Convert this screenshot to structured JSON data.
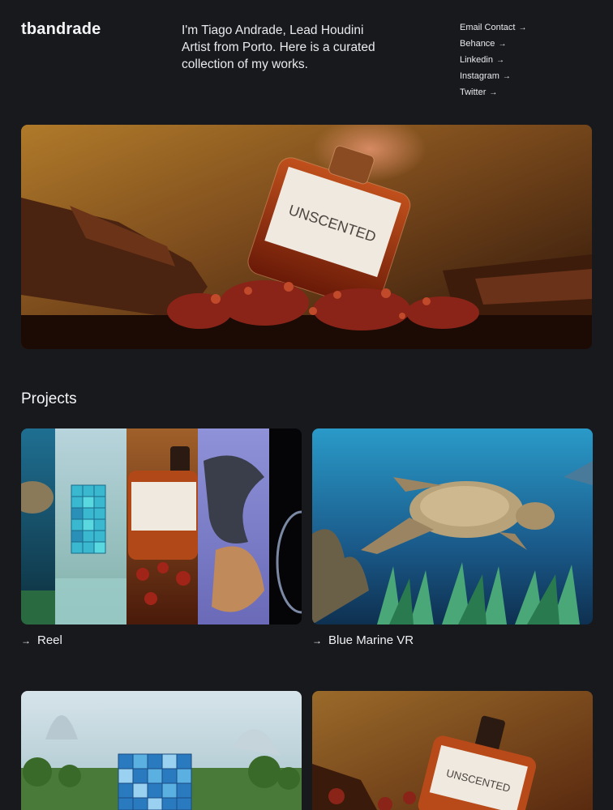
{
  "header": {
    "logo": "tbandrade",
    "intro": "I'm Tiago Andrade, Lead Houdini Artist from Porto. Here is a curated collection of my works.",
    "links": [
      "Email Contact",
      "Behance",
      "Linkedin",
      "Instagram",
      "Twitter"
    ],
    "arrow": "→"
  },
  "hero": {
    "label_text": "UNSCENTED"
  },
  "projects": {
    "title": "Projects",
    "items": [
      {
        "title": "Reel"
      },
      {
        "title": "Blue Marine VR"
      }
    ]
  },
  "colors": {
    "background": "#17191d",
    "text": "#eef0f2"
  }
}
